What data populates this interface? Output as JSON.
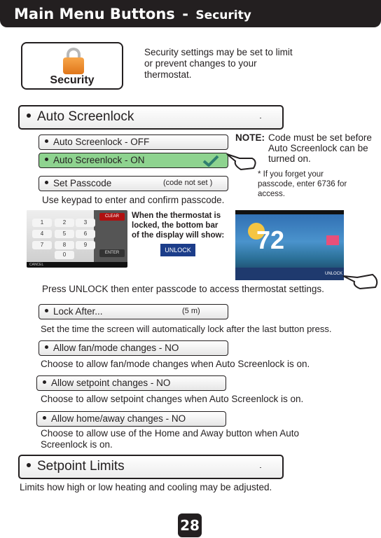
{
  "header": {
    "title": "Main Menu Buttons",
    "separator": "-",
    "section": "Security"
  },
  "security_button": {
    "label": "Security",
    "icon": "padlock-icon"
  },
  "intro": "Security settings may be set to limit or prevent changes to your thermostat.",
  "auto_screenlock": {
    "label": "Auto Screenlock",
    "options": [
      {
        "label": "Auto Screenlock - OFF",
        "selected": false
      },
      {
        "label": "Auto Screenlock - ON",
        "selected": true
      }
    ],
    "set_passcode": {
      "label": "Set Passcode",
      "status": "(code not set )"
    },
    "note_label": "NOTE:",
    "note": "Code must be set before Auto Screenlock can be turned on.",
    "forgot": "* If you forget your passcode, enter 6736 for access.",
    "keypad_hint": "Use keypad to enter and confirm passcode.",
    "locked_text": "When the thermostat is locked, the bottom bar of the display will show:",
    "unlock_label": "UNLOCK",
    "keypad": {
      "keys": [
        "1",
        "2",
        "3",
        "4",
        "5",
        "6",
        "7",
        "8",
        "9",
        "0"
      ],
      "clear": "CLEAR",
      "enter": "ENTER",
      "cancel": "CANCEL"
    },
    "thermostat": {
      "temp": "72",
      "unlock": "UNLOCK"
    },
    "press_unlock": "Press UNLOCK then enter passcode to access thermostat settings."
  },
  "lock_after": {
    "label": "Lock After...",
    "value": "(5 m)",
    "desc": "Set the time the screen will automatically lock after the last button press."
  },
  "fan_mode": {
    "label": "Allow fan/mode changes - NO",
    "desc": "Choose to allow fan/mode changes when Auto Screenlock is on."
  },
  "setpoint_changes": {
    "label": "Allow setpoint changes - NO",
    "desc": "Choose to allow setpoint changes when Auto Screenlock is on."
  },
  "home_away": {
    "label": "Allow home/away changes - NO",
    "desc": "Choose to allow use of the Home and Away button when Auto Screenlock is on."
  },
  "setpoint_limits": {
    "label": "Setpoint Limits",
    "desc": "Limits how high or low heating and cooling may be adjusted."
  },
  "page_number": "28",
  "colors": {
    "header": "#231f20",
    "selected": "#8ed38f",
    "check": "#2f7f6f",
    "unlock_button": "#1c3d8a"
  }
}
